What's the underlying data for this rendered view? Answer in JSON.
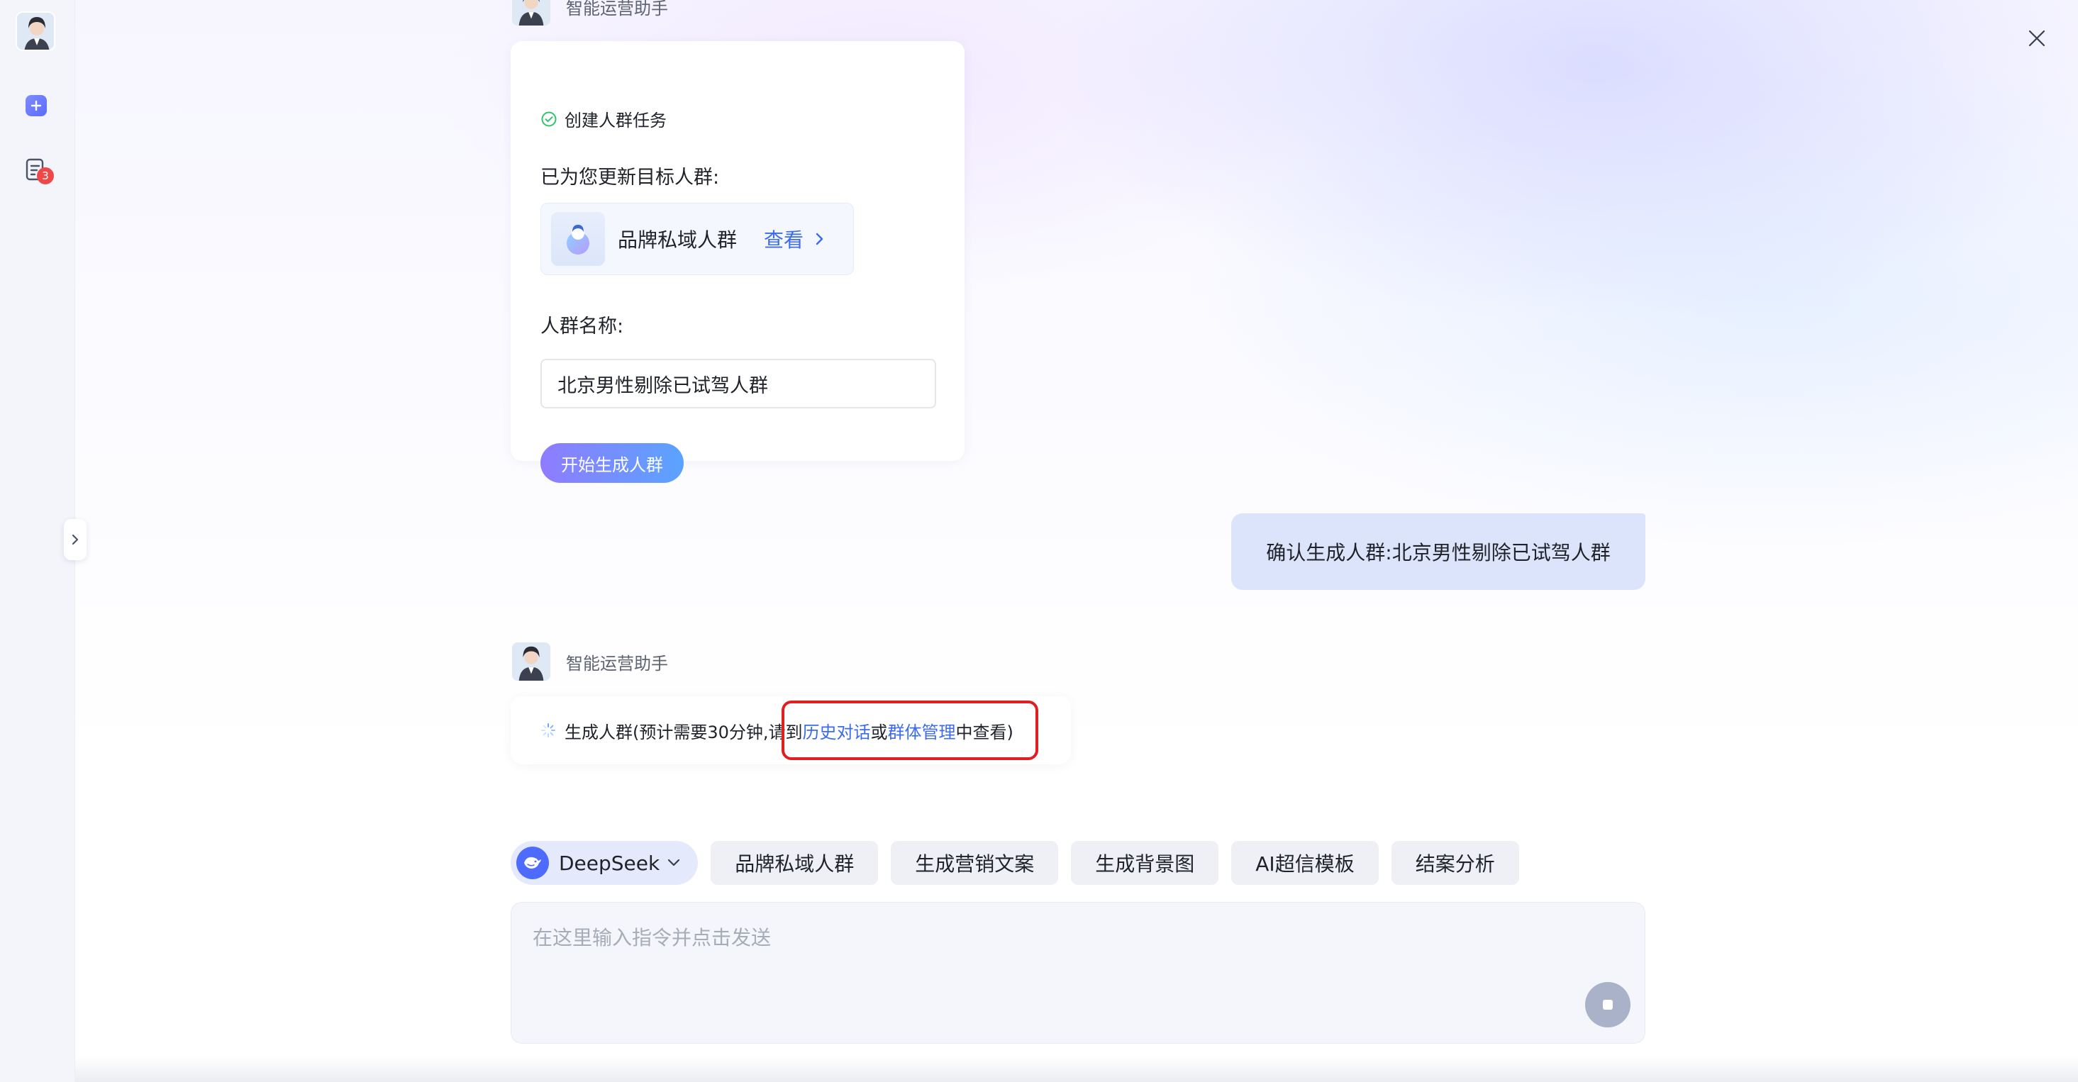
{
  "app": {
    "assistant_name": "智能运营助手"
  },
  "rail": {
    "icons": [
      "avatar",
      "new-chat-icon",
      "task-list-icon"
    ],
    "task_badge_count": "3"
  },
  "messages": {
    "card1": {
      "task_title": "创建人群任务",
      "updated_label": "已为您更新目标人群:",
      "crowd_name": "品牌私域人群",
      "view_label": "查看",
      "name_label": "人群名称:",
      "name_value": "北京男性剔除已试驾人群",
      "generate_button": "开始生成人群"
    },
    "user": {
      "text": "确认生成人群:北京男性剔除已试驾人群"
    },
    "card2": {
      "prefix": "生成人群(预计需要30分钟,",
      "mid1": "请到",
      "link1": "历史对话",
      "mid2": "或",
      "link2": "群体管理",
      "suffix": "中查看)"
    }
  },
  "toolbar": {
    "model": "DeepSeek",
    "chips": [
      "品牌私域人群",
      "生成营销文案",
      "生成背景图",
      "AI超信模板",
      "结案分析"
    ]
  },
  "composer": {
    "placeholder": "在这里输入指令并点击发送"
  },
  "colors": {
    "accent": "#3d6bf0",
    "user_bubble": "#dbe4fb",
    "highlight": "#e02020",
    "success": "#34c26b"
  }
}
